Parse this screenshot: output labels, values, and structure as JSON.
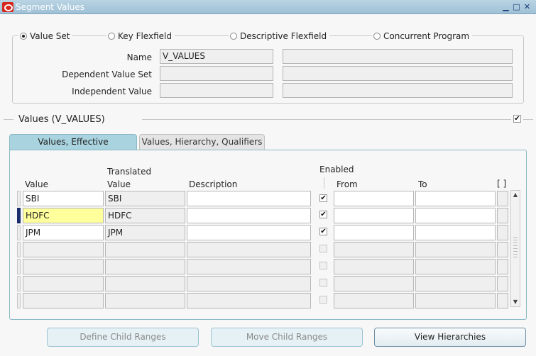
{
  "window": {
    "title": "Segment Values",
    "controls": {
      "minimize": "▁",
      "maximize": "□",
      "close": "✕"
    }
  },
  "source": {
    "options": [
      {
        "label": "Value Set",
        "selected": true
      },
      {
        "label": "Key Flexfield",
        "selected": false
      },
      {
        "label": "Descriptive Flexfield",
        "selected": false
      },
      {
        "label": "Concurrent Program",
        "selected": false
      }
    ],
    "name_label": "Name",
    "name_value": "V_VALUES",
    "dependent_label": "Dependent Value Set",
    "dependent_value": "",
    "independent_label": "Independent Value",
    "independent_value": ""
  },
  "values_section": {
    "title": "Values (V_VALUES)",
    "checked": true
  },
  "tabs": [
    {
      "label": "Values, Effective",
      "active": true
    },
    {
      "label": "Values, Hierarchy, Qualifiers",
      "active": false
    }
  ],
  "columns": {
    "value": "Value",
    "translated_line1": "Translated",
    "translated_line2": "Value",
    "description": "Description",
    "enabled": "Enabled",
    "from": "From",
    "to": "To",
    "flex": "[ ]"
  },
  "rows": [
    {
      "value": "SBI",
      "translated": "SBI",
      "description": "",
      "enabled": true,
      "from": "",
      "to": ""
    },
    {
      "value": "HDFC",
      "translated": "HDFC",
      "description": "",
      "enabled": true,
      "from": "",
      "to": ""
    },
    {
      "value": "JPM",
      "translated": "JPM",
      "description": "",
      "enabled": true,
      "from": "",
      "to": ""
    },
    {
      "value": "",
      "translated": "",
      "description": "",
      "enabled": false,
      "from": "",
      "to": ""
    },
    {
      "value": "",
      "translated": "",
      "description": "",
      "enabled": false,
      "from": "",
      "to": ""
    },
    {
      "value": "",
      "translated": "",
      "description": "",
      "enabled": false,
      "from": "",
      "to": ""
    },
    {
      "value": "",
      "translated": "",
      "description": "",
      "enabled": false,
      "from": "",
      "to": ""
    }
  ],
  "buttons": {
    "define_child_ranges": "Define Child Ranges",
    "move_child_ranges": "Move Child Ranges",
    "view_hierarchies": "View Hierarchies"
  },
  "colors": {
    "titlebar": "#a8c8da",
    "active_tab": "#a9d3df",
    "current_field": "#ffff9c",
    "row_indicator": "#1c2d6e"
  }
}
